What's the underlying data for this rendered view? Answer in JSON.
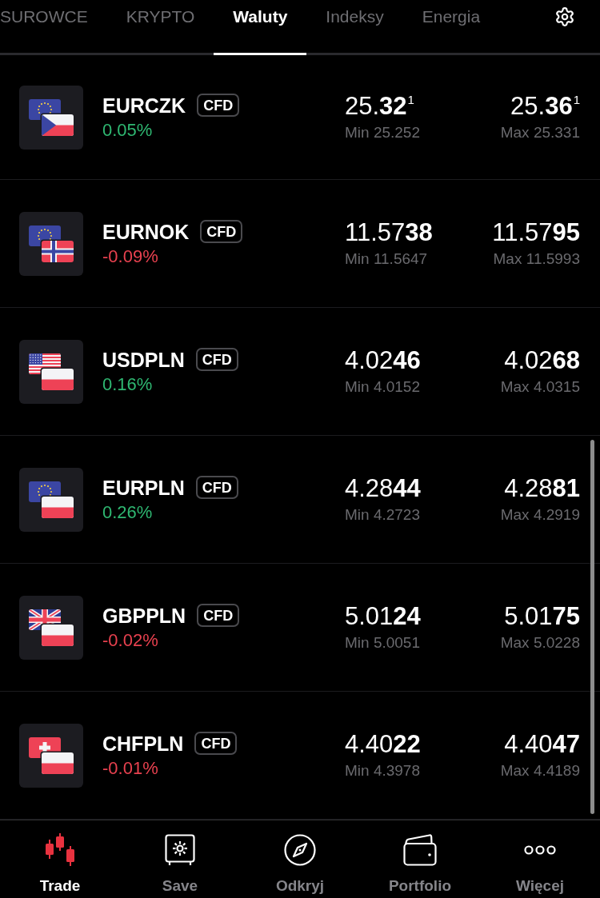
{
  "tabs": [
    {
      "label": "SUROWCE",
      "selected": false
    },
    {
      "label": "KRYPTO",
      "selected": false
    },
    {
      "label": "Waluty",
      "selected": true
    },
    {
      "label": "Indeksy",
      "selected": false
    },
    {
      "label": "Energia",
      "selected": false
    }
  ],
  "instruments": [
    {
      "symbol": "EURCZK",
      "badge": "CFD",
      "change": "0.05%",
      "color": "#2fb872",
      "flags": [
        {
          "kind": "eu"
        },
        {
          "kind": "cz"
        }
      ],
      "bid": "25.**32**$^{1}$",
      "bid_low": "Min 25.252",
      "ask": "25.**36**$^{1}$",
      "ask_high": "Max 25.331"
    },
    {
      "symbol": "EURNOK",
      "badge": "CFD",
      "change": "-0.09%",
      "color": "#e8414f",
      "flags": [
        {
          "kind": "eu"
        },
        {
          "kind": "no"
        }
      ],
      "bid": "11.57**38**",
      "bid_low": "Min 11.5647",
      "ask": "11.57**95**",
      "ask_high": "Max 11.5993"
    },
    {
      "symbol": "USDPLN",
      "badge": "CFD",
      "change": "0.16%",
      "color": "#2fb872",
      "flags": [
        {
          "kind": "us"
        },
        {
          "kind": "pl"
        }
      ],
      "bid": "4.02**46**",
      "bid_low": "Min 4.0152",
      "ask": "4.02**68**",
      "ask_high": "Max 4.0315"
    },
    {
      "symbol": "EURPLN",
      "badge": "CFD",
      "change": "0.26%",
      "color": "#2fb872",
      "flags": [
        {
          "kind": "eu"
        },
        {
          "kind": "pl"
        }
      ],
      "bid": "4.28**44**",
      "bid_low": "Min 4.2723",
      "ask": "4.28**81**",
      "ask_high": "Max 4.2919"
    },
    {
      "symbol": "GBPPLN",
      "badge": "CFD",
      "change": "-0.02%",
      "color": "#e8414f",
      "flags": [
        {
          "kind": "gb"
        },
        {
          "kind": "pl"
        }
      ],
      "bid": "5.01**24**",
      "bid_low": "Min 5.0051",
      "ask": "5.01**75**",
      "ask_high": "Max 5.0228"
    },
    {
      "symbol": "CHFPLN",
      "badge": "CFD",
      "change": "-0.01%",
      "color": "#e8414f",
      "flags": [
        {
          "kind": "ch"
        },
        {
          "kind": "pl"
        }
      ],
      "bid": "4.40**22**",
      "bid_low": "Min 4.3978",
      "ask": "4.40**47**",
      "ask_high": "Max 4.4189"
    }
  ],
  "nav": [
    {
      "label": "Trade",
      "selected": true,
      "kind": "candles"
    },
    {
      "label": "Save",
      "selected": false,
      "kind": "safe"
    },
    {
      "label": "Odkryj",
      "selected": false,
      "kind": "compass"
    },
    {
      "label": "Portfolio",
      "selected": false,
      "kind": "wallet"
    },
    {
      "label": "Więcej",
      "selected": false,
      "kind": "more"
    }
  ]
}
